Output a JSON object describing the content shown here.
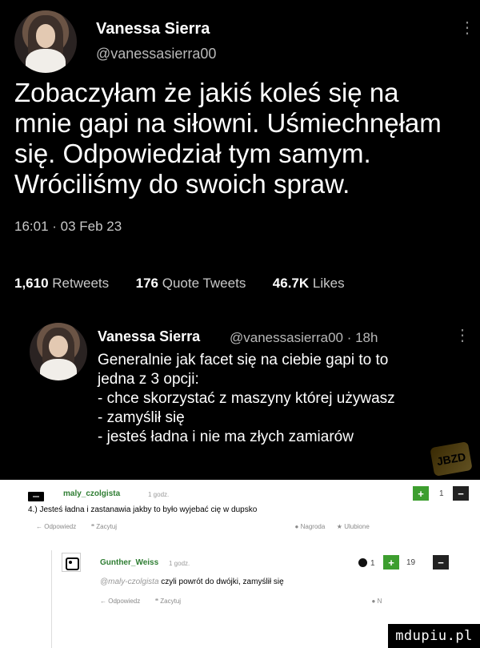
{
  "tweet": {
    "author_name": "Vanessa Sierra",
    "author_handle": "@vanessasierra00",
    "text_lines": [
      "Zobaczyłam że jakiś koleś się na",
      "mnie gapi na siłowni. Uśmiechnęłam",
      "się. Odpowiedział tym samym.",
      "Wróciliśmy do swoich spraw."
    ],
    "timestamp": "16:01 · 03 Feb 23",
    "stats": {
      "retweets_count": "1,610",
      "retweets_label": "Retweets",
      "quotes_count": "176",
      "quotes_label": "Quote Tweets",
      "likes_count": "46.7K",
      "likes_label": "Likes"
    }
  },
  "reply_tweet": {
    "author_name": "Vanessa Sierra",
    "author_handle": "@vanessasierra00 · 18h",
    "text_lines": [
      "Generalnie jak facet się na ciebie gapi to to",
      "jedna z 3 opcji:",
      "- chce skorzystać z maszyny której używasz",
      "- zamyślił się",
      "- jesteś ładna i nie ma złych zamiarów"
    ]
  },
  "badge": {
    "label": "JBZD"
  },
  "comments": [
    {
      "user": "maly_czolgista",
      "time": "1 godz.",
      "score": "1",
      "text": "4.) Jesteś ładna i zastanawia jakby to było wyjebać cię w dupsko",
      "actions": {
        "reply": "Odpowiedz",
        "quote": "Zacytuj",
        "award": "Nagroda",
        "favorite": "Ulubione"
      }
    },
    {
      "user": "Gunther_Weiss",
      "time": "1 godz.",
      "award_count": "1",
      "score": "19",
      "mention": "@maly-czolgista",
      "text": "czyli powrót do dwójki, zamyślił się",
      "actions": {
        "reply": "Odpowiedz",
        "quote": "Zacytuj",
        "award": "N"
      }
    }
  ],
  "watermark": {
    "text": "mdupiu.pl"
  }
}
